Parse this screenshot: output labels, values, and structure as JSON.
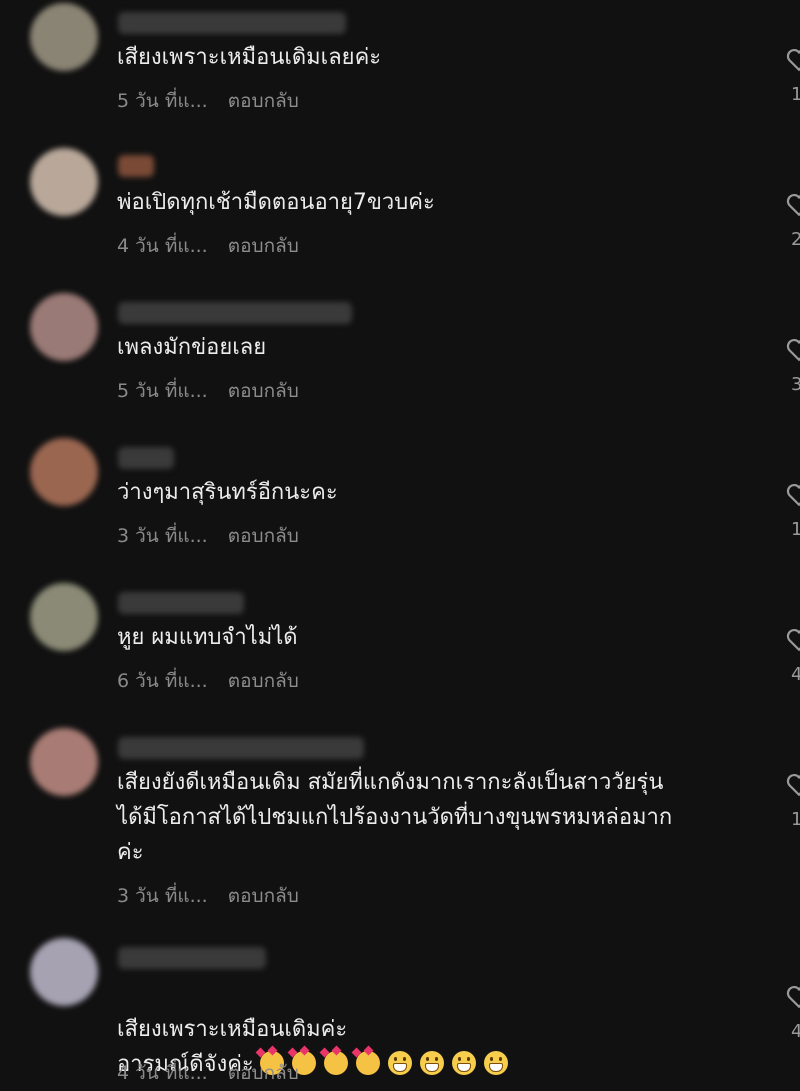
{
  "comments": [
    {
      "text": "เสียงเพราะเหมือนเดิมเลยค่ะ",
      "time": "5 วัน ที่แ...",
      "reply": "ตอบกลับ",
      "likes": "1",
      "avatar_color": "#8a8474"
    },
    {
      "text": "พ่อเปิดทุกเช้ามืดตอนอายุ7ขวบค่ะ",
      "time": "4 วัน ที่แ...",
      "reply": "ตอบกลับ",
      "likes": "2",
      "avatar_color": "#b9a89a"
    },
    {
      "text": "เพลงมักข่อยเลย",
      "time": "5 วัน ที่แ...",
      "reply": "ตอบกลับ",
      "likes": "3",
      "avatar_color": "#9a7a76"
    },
    {
      "text": "ว่างๆมาสุรินทร์อีกนะคะ",
      "time": "3 วัน ที่แ...",
      "reply": "ตอบกลับ",
      "likes": "1",
      "avatar_color": "#9a6650"
    },
    {
      "text": "หูย ผมแทบจำไม่ได้",
      "time": "6 วัน ที่แ...",
      "reply": "ตอบกลับ",
      "likes": "4",
      "avatar_color": "#8a8a76"
    },
    {
      "text": "เสียงยังดีเหมือนเดิม สมัยที่แกดังมากเรากะลังเป็นสาววัยรุ่น\nได้มีโอกาสได้ไปชมแกไปร้องงานวัดที่บางขุนพรหมหล่อมาก\nค่ะ",
      "time": "3 วัน ที่แ...",
      "reply": "ตอบกลับ",
      "likes": "1",
      "avatar_color": "#a87c74"
    },
    {
      "text": "เสียงเพราะเหมือนเดิมค่ะ\nอารมณ์ดีจังค่ะ",
      "time": "4 วัน ที่แ...",
      "reply": "ตอบกลับ",
      "likes": "4",
      "avatar_color": "#a6a2b2"
    }
  ],
  "colors": {
    "background": "#111111",
    "text": "#ececec",
    "muted": "#8a8a8a"
  },
  "icons": {
    "like": "heart-outline-icon"
  }
}
